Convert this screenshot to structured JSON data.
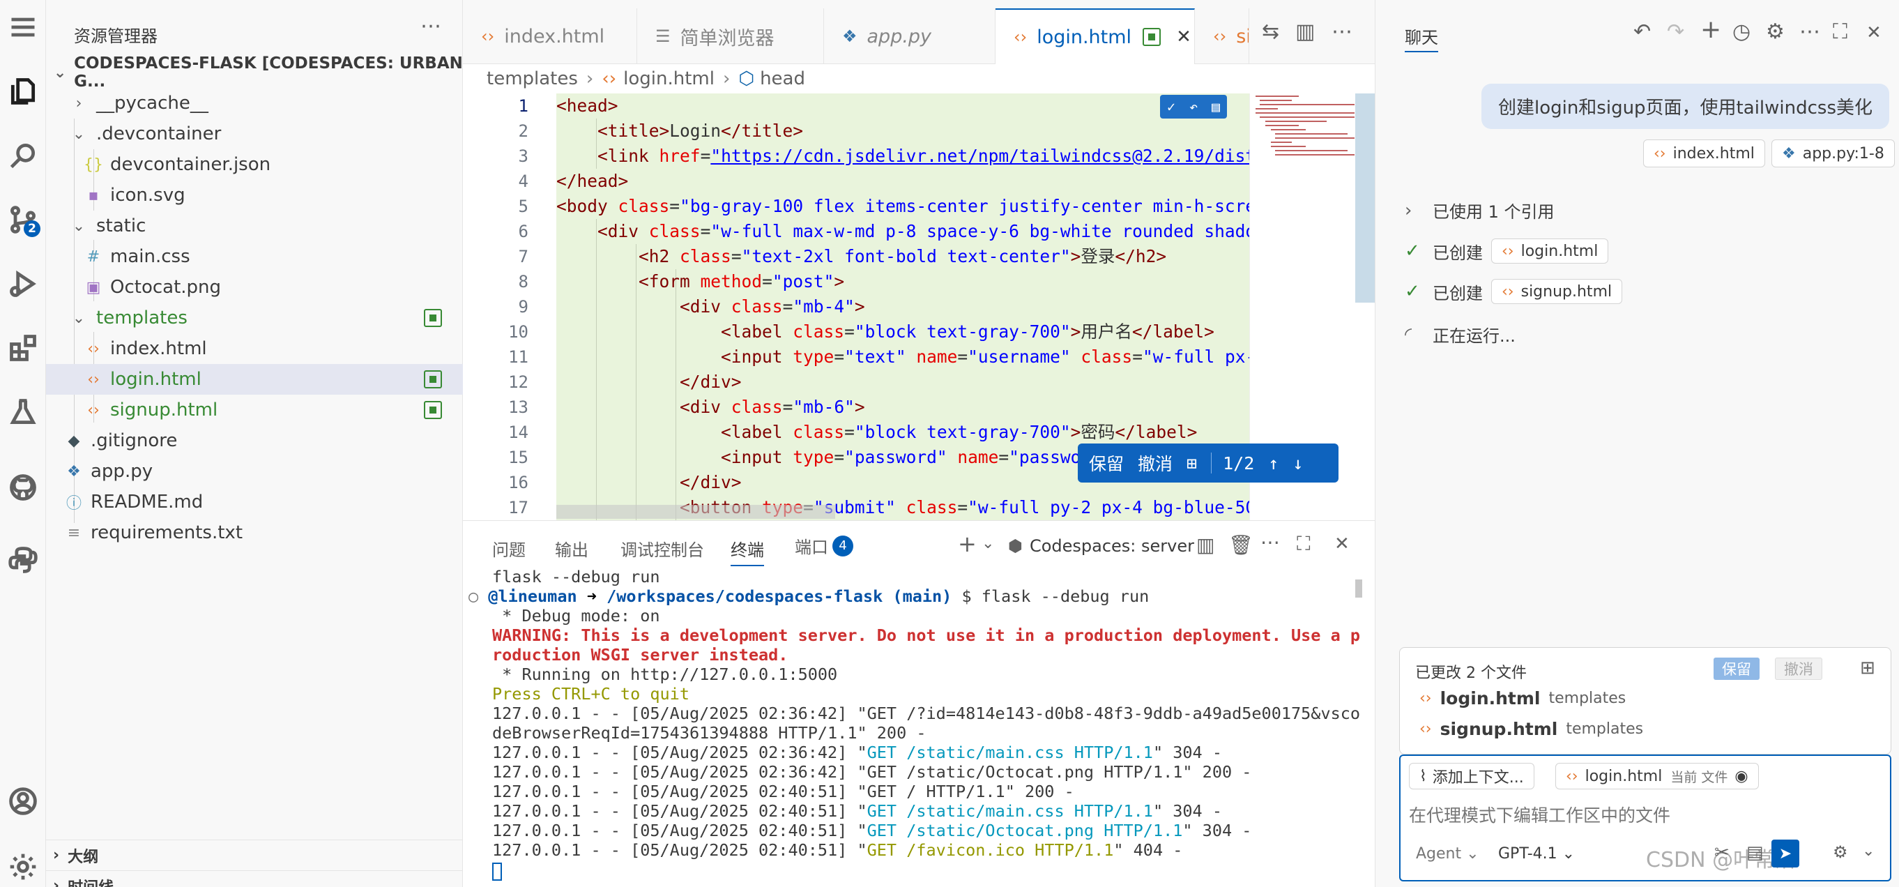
{
  "explorer": {
    "title": "资源管理器",
    "root": "CODESPACES-FLASK [CODESPACES: URBAN G...",
    "items": [
      {
        "label": "__pycache__",
        "icon": "chevron-right-icon"
      },
      {
        "label": ".devcontainer",
        "icon": "chevron-down-icon"
      },
      {
        "label": "devcontainer.json",
        "icon": "json-icon"
      },
      {
        "label": "icon.svg",
        "icon": "svg-icon"
      },
      {
        "label": "static",
        "icon": "chevron-down-icon"
      },
      {
        "label": "main.css",
        "icon": "css-icon"
      },
      {
        "label": "Octocat.png",
        "icon": "image-icon"
      },
      {
        "label": "templates",
        "icon": "chevron-down-icon"
      },
      {
        "label": "index.html",
        "icon": "html-icon"
      },
      {
        "label": "login.html",
        "icon": "html-icon"
      },
      {
        "label": "signup.html",
        "icon": "html-icon"
      },
      {
        "label": ".gitignore",
        "icon": "git-icon"
      },
      {
        "label": "app.py",
        "icon": "python-icon"
      },
      {
        "label": "README.md",
        "icon": "info-icon"
      },
      {
        "label": "requirements.txt",
        "icon": "text-icon"
      }
    ],
    "outline": "大纲",
    "timeline": "时间线"
  },
  "activity": {
    "scm_badge": "2"
  },
  "tabs": [
    {
      "label": "index.html"
    },
    {
      "label": "简单浏览器"
    },
    {
      "label": "app.py"
    },
    {
      "label": "login.html"
    },
    {
      "label": "sign"
    }
  ],
  "breadcrumb": {
    "a": "templates",
    "b": "login.html",
    "c": "head"
  },
  "editor": {
    "lines": [
      "1",
      "2",
      "3",
      "4",
      "5",
      "6",
      "7",
      "8",
      "9",
      "10",
      "11",
      "12",
      "13",
      "14",
      "15",
      "16",
      "17"
    ],
    "keep_bar": {
      "keep": "保留",
      "undo": "撤消",
      "count": "1/2"
    }
  },
  "panel": {
    "tabs": [
      "问题",
      "输出",
      "调试控制台",
      "终端",
      "端口"
    ],
    "ports_badge": "4",
    "terminal_name": "Codespaces: server",
    "terminal": {
      "l1": "flask --debug run",
      "prompt_user": "@lineuman",
      "prompt_arrow": "➜",
      "prompt_path": "/workspaces/codespaces-flask",
      "prompt_branch": "(main)",
      "prompt_cmd": "$ flask --debug run",
      "debug": " * Debug mode: on",
      "warn1": "WARNING: This is a development server. Do not use it in a production deployment. Use a p",
      "warn2": "roduction WSGI server instead.",
      "running": " * Running on http://127.0.0.1:5000",
      "quit": "Press CTRL+C to quit",
      "r1a": "127.0.0.1 - - [05/Aug/2025 02:36:42] \"GET /?id=4814e143-d0b8-48f3-9ddb-a49ad5e00175&vsco",
      "r1b": "deBrowserReqId=1754361394888 HTTP/1.1\" 200 -",
      "r2pre": "127.0.0.1 - - [05/Aug/2025 02:36:42] \"",
      "r2": "GET /static/main.css HTTP/1.1",
      "r2post": "\" 304 -",
      "r3": "127.0.0.1 - - [05/Aug/2025 02:36:42] \"GET /static/Octocat.png HTTP/1.1\" 200 -",
      "r4": "127.0.0.1 - - [05/Aug/2025 02:40:51] \"GET / HTTP/1.1\" 200 -",
      "r5pre": "127.0.0.1 - - [05/Aug/2025 02:40:51] \"",
      "r5": "GET /static/main.css HTTP/1.1",
      "r5post": "\" 304 -",
      "r6pre": "127.0.0.1 - - [05/Aug/2025 02:40:51] \"",
      "r6": "GET /static/Octocat.png HTTP/1.1",
      "r6post": "\" 304 -",
      "r7pre": "127.0.0.1 - - [05/Aug/2025 02:40:51] \"",
      "r7": "GET /favicon.ico HTTP/1.1",
      "r7post": "\" 404 -"
    }
  },
  "chat": {
    "title": "聊天",
    "user_message": "创建login和sigup页面，使用tailwindcss美化",
    "ref_chips": [
      "index.html",
      "app.py:1-8"
    ],
    "refs_used": "已使用 1 个引用",
    "created_label": "已创建",
    "created_files": [
      "login.html",
      "signup.html"
    ],
    "running": "正在运行...",
    "changes_title": "已更改 2 个文件",
    "keep": "保留",
    "undo": "撤消",
    "changed_files": [
      {
        "name": "login.html",
        "dir": "templates"
      },
      {
        "name": "signup.html",
        "dir": "templates"
      }
    ],
    "add_context": "添加上下文...",
    "current_file": "login.html",
    "current_file_tag": "当前 文件",
    "placeholder": "在代理模式下编辑工作区中的文件",
    "mode": "Agent",
    "model": "GPT-4.1",
    "watermark": "CSDN @叶常落"
  }
}
